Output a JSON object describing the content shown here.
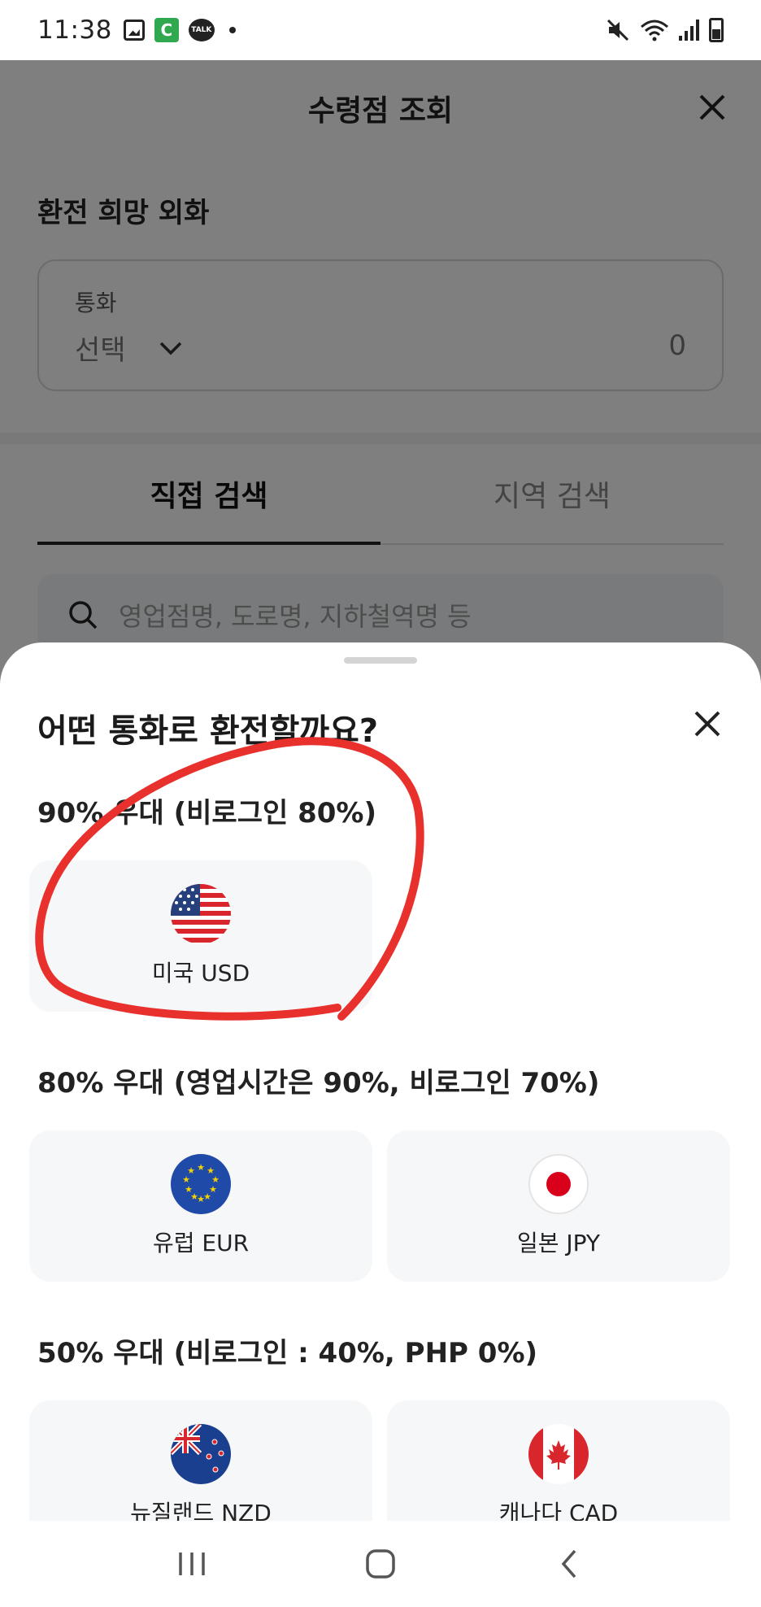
{
  "status_bar": {
    "time": "11:38",
    "talk_badge": "TALK",
    "c_badge": "C"
  },
  "page": {
    "title": "수령점 조회",
    "section_label": "환전 희망 외화",
    "currency_box": {
      "label": "통화",
      "select_text": "선택",
      "amount": "0"
    },
    "tabs": [
      {
        "label": "직접 검색",
        "active": true
      },
      {
        "label": "지역 검색",
        "active": false
      }
    ],
    "search_placeholder": "영업점명, 도로명, 지하철역명 등"
  },
  "sheet": {
    "title": "어떤 통화로 환전할까요?",
    "groups": [
      {
        "label": "90% 우대 (비로그인 80%)",
        "items": [
          {
            "label": "미국 USD",
            "flag": "us-flag-icon"
          }
        ]
      },
      {
        "label": "80% 우대 (영업시간은 90%, 비로그인 70%)",
        "items": [
          {
            "label": "유럽 EUR",
            "flag": "eu-flag-icon"
          },
          {
            "label": "일본 JPY",
            "flag": "jp-flag-icon"
          }
        ]
      },
      {
        "label": "50% 우대 (비로그인 : 40%, PHP 0%)",
        "items": [
          {
            "label": "뉴질랜드 NZD",
            "flag": "nz-flag-icon"
          },
          {
            "label": "캐나다 CAD",
            "flag": "ca-flag-icon"
          }
        ]
      }
    ]
  },
  "colors": {
    "annotation_red": "#e8302c",
    "card_bg": "#f6f7f9",
    "eu_blue": "#1f4aa8",
    "jp_red": "#d9001b"
  }
}
